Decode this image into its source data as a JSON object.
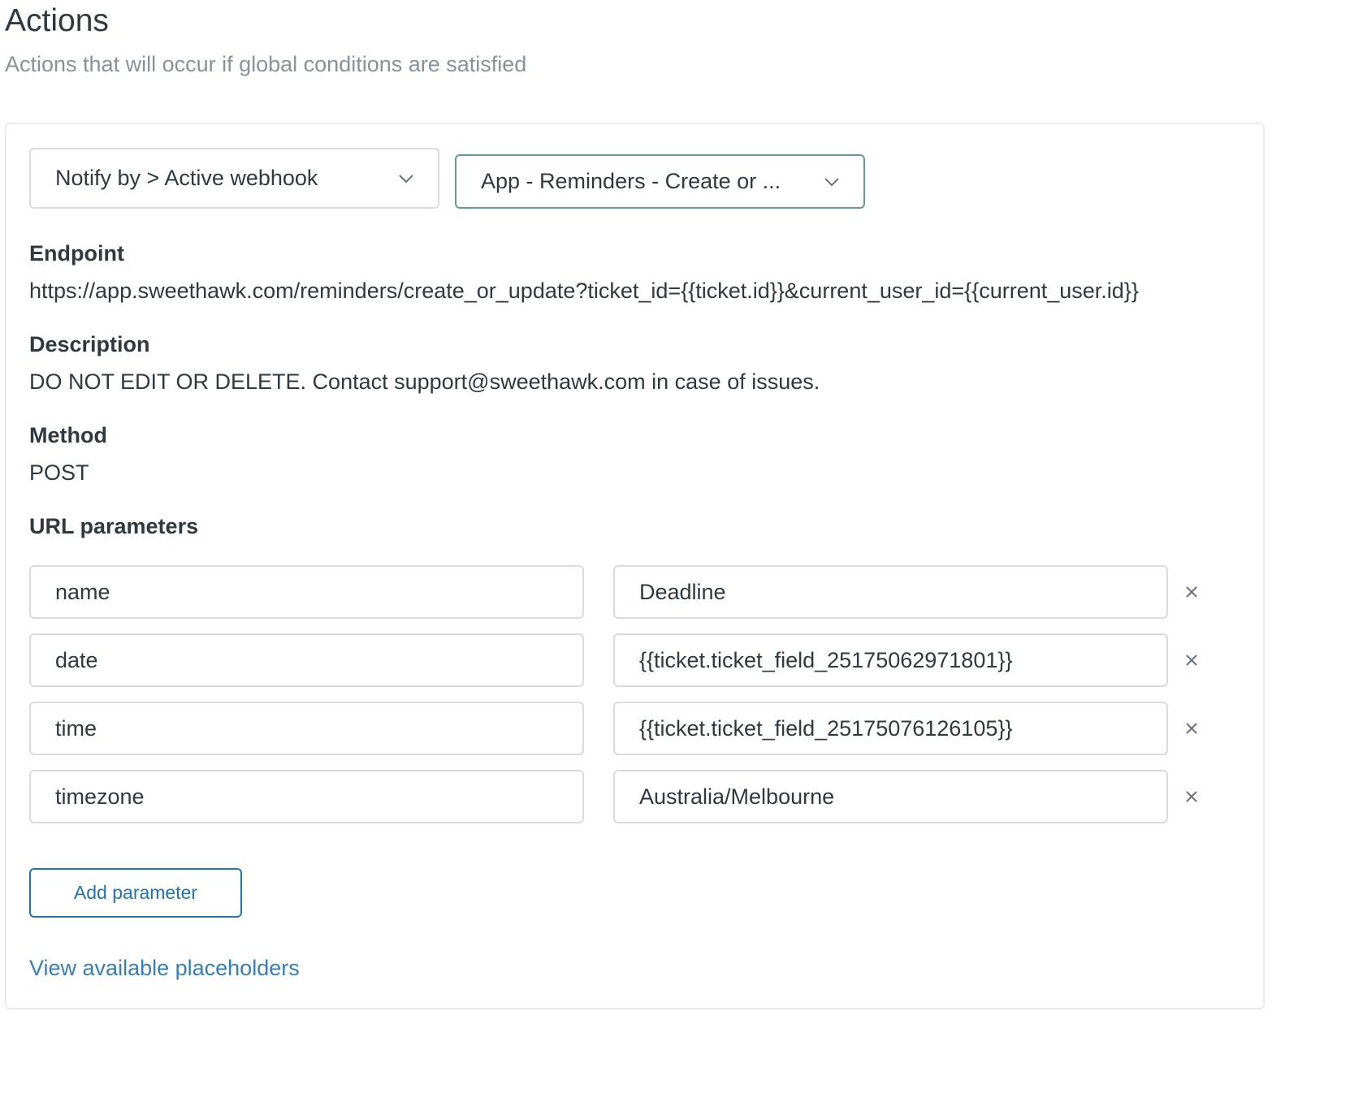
{
  "header": {
    "title": "Actions",
    "subtitle": "Actions that will occur if global conditions are satisfied"
  },
  "action": {
    "type_select": {
      "value": "Notify by > Active webhook",
      "icon": "chevron-down-icon"
    },
    "target_select": {
      "value": "App - Reminders - Create or ...",
      "icon": "chevron-down-icon"
    }
  },
  "webhook": {
    "endpoint_label": "Endpoint",
    "endpoint_value": "https://app.sweethawk.com/reminders/create_or_update?ticket_id={{ticket.id}}&current_user_id={{current_user.id}}",
    "description_label": "Description",
    "description_value": "DO NOT EDIT OR DELETE. Contact support@sweethawk.com in case of issues.",
    "method_label": "Method",
    "method_value": "POST"
  },
  "url_parameters": {
    "label": "URL parameters",
    "rows": [
      {
        "key": "name",
        "value": "Deadline"
      },
      {
        "key": "date",
        "value": "{{ticket.ticket_field_25175062971801}}"
      },
      {
        "key": "time",
        "value": "{{ticket.ticket_field_25175076126105}}"
      },
      {
        "key": "timezone",
        "value": "Australia/Melbourne"
      }
    ],
    "remove_icon": "close-icon",
    "add_button": "Add parameter"
  },
  "footer": {
    "placeholders_link": "View available placeholders"
  },
  "colors": {
    "text": "#2f3941",
    "muted": "#87929d",
    "border": "#d8dcde",
    "focus_border": "#5ea08a",
    "primary": "#1f73b7",
    "link": "#337fbd"
  }
}
